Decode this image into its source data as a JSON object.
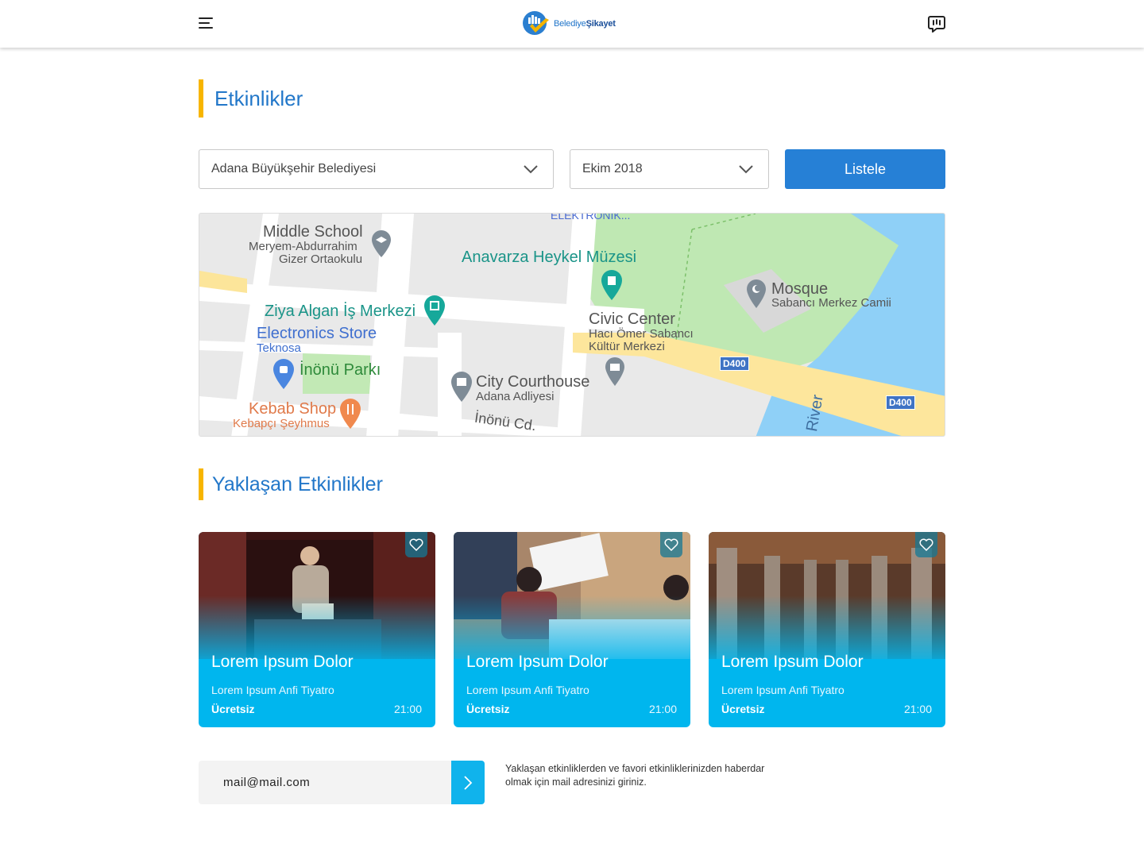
{
  "header": {
    "logo_prefix": "Belediye",
    "logo_suffix": "Şikayet",
    "menu_icon": "hamburger-menu-icon",
    "chat_icon": "chat-bubble-icon"
  },
  "page": {
    "title": "Etkinlikler",
    "upcoming_title": "Yaklaşan Etkinlikler"
  },
  "filters": {
    "municipality": "Adana Büyükşehir Belediyesi",
    "month": "Ekim 2018",
    "list_button": "Listele"
  },
  "map": {
    "labels": {
      "school": "Middle School",
      "school_name1": "Meryem-Abdurrahim",
      "school_name2": "Gizer Ortaokulu",
      "museum": "Anavarza Heykel Müzesi",
      "mosque": "Mosque",
      "mosque_name": "Sabancı Merkez Camii",
      "business": "Ziya Algan İş Merkezi",
      "electronics": "Electronics Store",
      "electronics_name": "Teknosa",
      "civic": "Civic Center",
      "civic_name1": "Hacı Ömer Sabancı",
      "civic_name2": "Kültür Merkezi",
      "park": "İnönü Parkı",
      "courthouse": "City Courthouse",
      "courthouse_name": "Adana Adliyesi",
      "kebab": "Kebab Shop",
      "kebab_name": "Kebapçı Şeyhmus",
      "street": "İnönü Cd.",
      "road1": "D400",
      "road2": "D400",
      "river": "River",
      "top_cut": "ELEKTRONİK..."
    }
  },
  "events": [
    {
      "title": "Lorem Ipsum Dolor",
      "venue": "Lorem Ipsum Anfi Tiyatro",
      "price": "Ücretsiz",
      "time": "21:00"
    },
    {
      "title": "Lorem Ipsum Dolor",
      "venue": "Lorem Ipsum Anfi Tiyatro",
      "price": "Ücretsiz",
      "time": "21:00"
    },
    {
      "title": "Lorem Ipsum Dolor",
      "venue": "Lorem Ipsum Anfi Tiyatro",
      "price": "Ücretsiz",
      "time": "21:00"
    }
  ],
  "newsletter": {
    "email_value": "mail@mail.com",
    "note_line1": "Yaklaşan etkinliklerden ve favori etkinliklerinizden haberdar",
    "note_line2": "olmak için mail adresinizi  giriniz."
  },
  "colors": {
    "accent_blue": "#2277c9",
    "button_blue": "#2680d6",
    "card_cyan": "#00b6ee",
    "title_bar_yellow": "#f7b500"
  }
}
